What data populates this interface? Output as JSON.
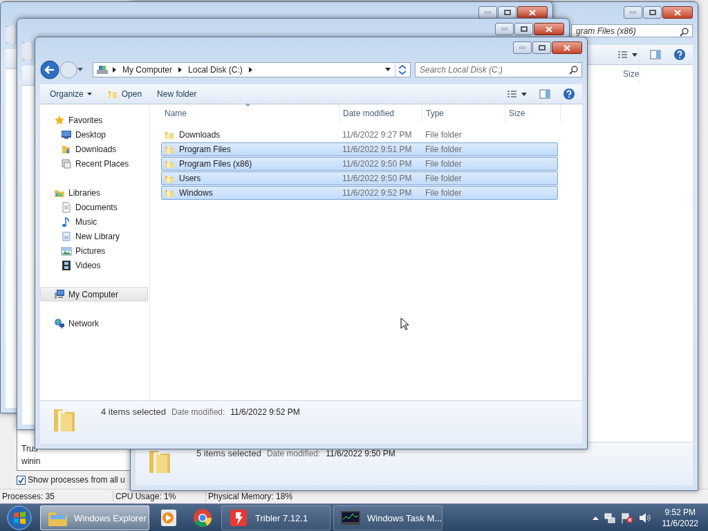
{
  "task_manager": {
    "list_text": [
      "Trus",
      "winin"
    ],
    "show_all_checkbox": {
      "label": "Show processes from all u",
      "checked": true
    },
    "status_bar": [
      "Processes: 35",
      "CPU Usage: 1%",
      "Physical Memory: 18%"
    ]
  },
  "rear_explorer": {
    "search_value": "gram Files (x86)",
    "column": "Size",
    "status": {
      "count": "5 items selected",
      "date_label": "Date modified:",
      "date": "11/6/2022 9:50 PM"
    }
  },
  "front_explorer": {
    "address": [
      "My Computer",
      "Local Disk (C:)"
    ],
    "search": {
      "placeholder": "Search Local Disk (C:)"
    },
    "toolbar": [
      {
        "label": "Organize",
        "kind": "menu"
      },
      {
        "label": "Open",
        "kind": "open"
      },
      {
        "label": "New folder",
        "kind": "plain"
      }
    ],
    "nav": [
      {
        "label": "Favorites",
        "selected": false,
        "children": [
          {
            "label": "Desktop",
            "selected": false
          },
          {
            "label": "Downloads",
            "selected": false
          },
          {
            "label": "Recent Places",
            "selected": false
          }
        ]
      },
      {
        "label": "Libraries",
        "selected": false,
        "children": [
          {
            "label": "Documents",
            "selected": false
          },
          {
            "label": "Music",
            "selected": false
          },
          {
            "label": "New Library",
            "selected": false
          },
          {
            "label": "Pictures",
            "selected": false
          },
          {
            "label": "Videos",
            "selected": false
          }
        ]
      },
      {
        "label": "My Computer",
        "selected": true
      },
      {
        "label": "Network",
        "selected": false
      }
    ],
    "columns": [
      "Name",
      "Date modified",
      "Type",
      "Size"
    ],
    "rows": [
      {
        "name": "Downloads",
        "date": "11/6/2022 9:27 PM",
        "type": "File folder",
        "selected": false
      },
      {
        "name": "Program Files",
        "date": "11/6/2022 9:51 PM",
        "type": "File folder",
        "selected": true
      },
      {
        "name": "Program Files (x86)",
        "date": "11/6/2022 9:50 PM",
        "type": "File folder",
        "selected": true
      },
      {
        "name": "Users",
        "date": "11/6/2022 9:50 PM",
        "type": "File folder",
        "selected": true
      },
      {
        "name": "Windows",
        "date": "11/6/2022 9:52 PM",
        "type": "File folder",
        "selected": true
      }
    ],
    "status": {
      "count": "4 items selected",
      "date_label": "Date modified:",
      "date": "11/6/2022 9:52 PM"
    }
  },
  "taskbar": {
    "items": [
      {
        "kind": "window",
        "label": "Windows Explorer",
        "selected": true
      },
      {
        "kind": "pinned",
        "selected": false
      },
      {
        "kind": "pinned",
        "selected": false
      },
      {
        "kind": "window",
        "label": "Tribler 7.12.1",
        "selected": false
      },
      {
        "kind": "window",
        "label": "Windows Task M...",
        "selected": false
      }
    ],
    "clock": {
      "time": "9:52 PM",
      "date": "11/6/2022"
    }
  }
}
